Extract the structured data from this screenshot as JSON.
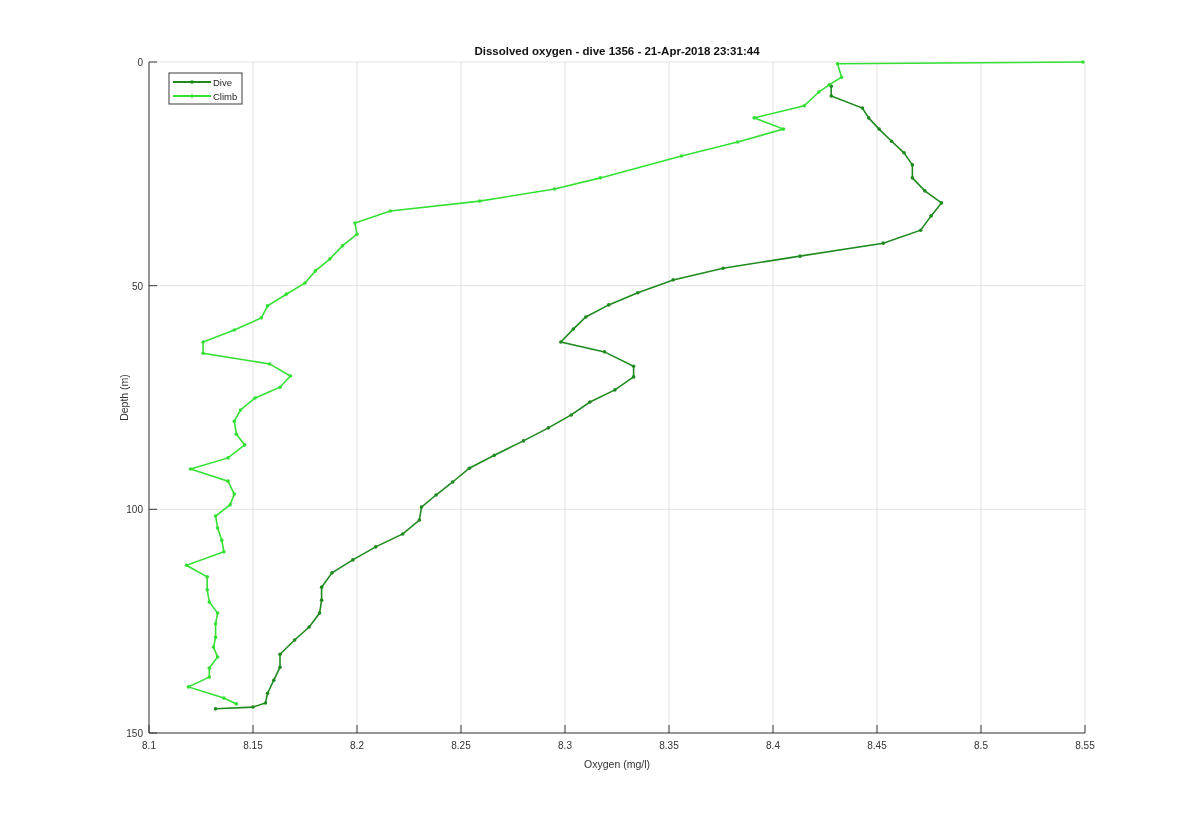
{
  "figure": {
    "chart_data": {
      "type": "line",
      "title": "Dissolved oxygen - dive 1356 - 21-Apr-2018 23:31:44",
      "xlabel": "Oxygen (mg/l)",
      "ylabel": "Depth (m)",
      "xlim": [
        8.1,
        8.55
      ],
      "ylim": [
        150,
        0
      ],
      "xticks": [
        8.1,
        8.15,
        8.2,
        8.25,
        8.3,
        8.35,
        8.4,
        8.45,
        8.5,
        8.55
      ],
      "yticks": [
        0,
        50,
        100,
        150
      ],
      "grid": true,
      "legend": "upper left",
      "series": [
        {
          "name": "Dive",
          "color": "#1f8a1f",
          "x": [
            8.428,
            8.428,
            8.443,
            8.446,
            8.451,
            8.457,
            8.463,
            8.467,
            8.467,
            8.473,
            8.481,
            8.476,
            8.471,
            8.453,
            8.413,
            8.376,
            8.352,
            8.335,
            8.321,
            8.31,
            8.304,
            8.298,
            8.319,
            8.333,
            8.333,
            8.324,
            8.312,
            8.303,
            8.292,
            8.28,
            8.266,
            8.254,
            8.246,
            8.238,
            8.231,
            8.23,
            8.222,
            8.209,
            8.198,
            8.188,
            8.183,
            8.183,
            8.182,
            8.177,
            8.17,
            8.163,
            8.163,
            8.16,
            8.157,
            8.156,
            8.15,
            8.132
          ],
          "values": [
            5.4,
            7.6,
            10.3,
            12.5,
            15,
            17.7,
            20.3,
            23,
            25.9,
            28.8,
            31.5,
            34.4,
            37.6,
            40.5,
            43.4,
            46.1,
            48.7,
            51.6,
            54.3,
            57,
            59.7,
            62.6,
            64.8,
            68,
            70.4,
            73.3,
            76,
            78.9,
            81.8,
            84.7,
            87.9,
            90.8,
            93.9,
            96.8,
            99.5,
            102.4,
            105.5,
            108.4,
            111.3,
            114.2,
            117.4,
            120.3,
            123.2,
            126.3,
            129.2,
            132.4,
            135.3,
            138.2,
            141.1,
            143.3,
            144.2,
            144.6
          ]
        },
        {
          "name": "Climb",
          "color": "#33e033",
          "x": [
            8.142,
            8.136,
            8.119,
            8.129,
            8.129,
            8.133,
            8.131,
            8.132,
            8.132,
            8.133,
            8.129,
            8.128,
            8.128,
            8.118,
            8.136,
            8.135,
            8.133,
            8.132,
            8.139,
            8.141,
            8.138,
            8.12,
            8.138,
            8.146,
            8.142,
            8.141,
            8.144,
            8.151,
            8.163,
            8.168,
            8.158,
            8.126,
            8.126,
            8.141,
            8.154,
            8.157,
            8.166,
            8.175,
            8.18,
            8.187,
            8.193,
            8.2,
            8.199,
            8.216,
            8.259,
            8.295,
            8.317,
            8.356,
            8.383,
            8.405,
            8.391,
            8.415,
            8.422,
            8.427,
            8.433,
            8.431,
            8.549
          ],
          "values": [
            143.5,
            142.2,
            139.7,
            137.5,
            135.5,
            133,
            130.8,
            128.6,
            125.6,
            123.2,
            120.7,
            118,
            115.1,
            112.5,
            109.5,
            106.9,
            104.2,
            101.5,
            99,
            96.6,
            93.7,
            91,
            88.5,
            85.6,
            83.2,
            80.3,
            77.8,
            75.1,
            72.7,
            70.2,
            67.5,
            65.1,
            62.6,
            59.9,
            57.2,
            54.5,
            51.9,
            49.4,
            46.7,
            44,
            41.1,
            38.5,
            36,
            33.3,
            31.1,
            28.4,
            25.9,
            21,
            17.9,
            15,
            12.5,
            9.8,
            6.7,
            5.1,
            3.4,
            0.4,
            0
          ]
        }
      ]
    }
  }
}
